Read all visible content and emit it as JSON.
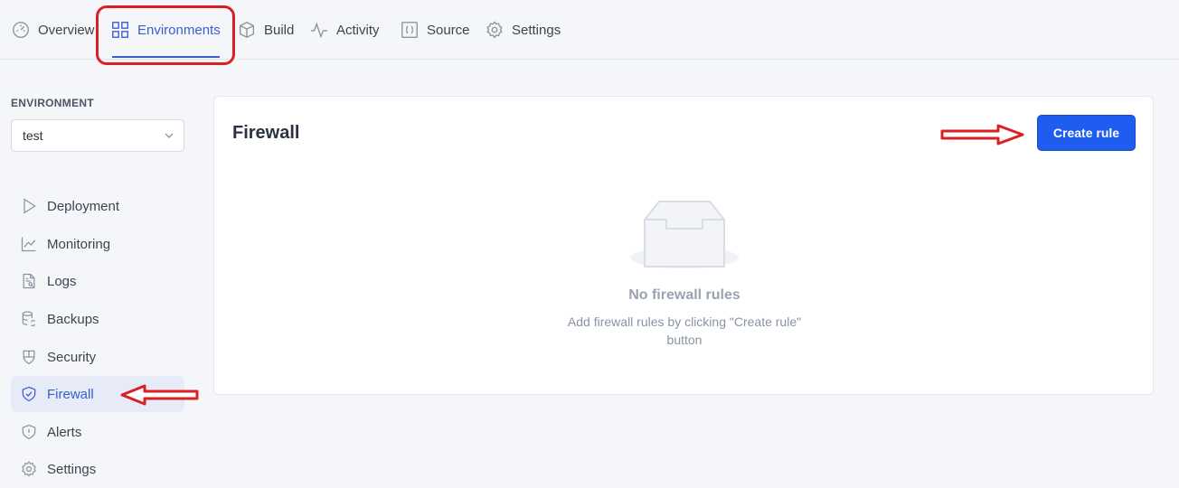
{
  "topnav": {
    "tabs": [
      {
        "label": "Overview",
        "icon": "dashboard-icon"
      },
      {
        "label": "Environments",
        "icon": "grid-icon",
        "active": true
      },
      {
        "label": "Build",
        "icon": "box-icon"
      },
      {
        "label": "Activity",
        "icon": "activity-icon"
      },
      {
        "label": "Source",
        "icon": "code-braces-icon"
      },
      {
        "label": "Settings",
        "icon": "gear-icon"
      }
    ]
  },
  "sidebar": {
    "environment_label": "ENVIRONMENT",
    "environment_value": "test",
    "items": [
      {
        "label": "Deployment",
        "icon": "play-icon"
      },
      {
        "label": "Monitoring",
        "icon": "chart-line-icon"
      },
      {
        "label": "Logs",
        "icon": "file-search-icon"
      },
      {
        "label": "Backups",
        "icon": "database-sync-icon"
      },
      {
        "label": "Security",
        "icon": "shield-icon"
      },
      {
        "label": "Firewall",
        "icon": "shield-check-icon",
        "active": true
      },
      {
        "label": "Alerts",
        "icon": "alert-icon"
      },
      {
        "label": "Settings",
        "icon": "gear-icon"
      }
    ]
  },
  "main": {
    "title": "Firewall",
    "create_button": "Create rule",
    "empty_title": "No firewall rules",
    "empty_description": "Add firewall rules by clicking \"Create rule\" button"
  },
  "colors": {
    "accent": "#3a5fcd",
    "button": "#1f5cf0",
    "annotation": "#d92125",
    "background": "#f5f6f9"
  }
}
